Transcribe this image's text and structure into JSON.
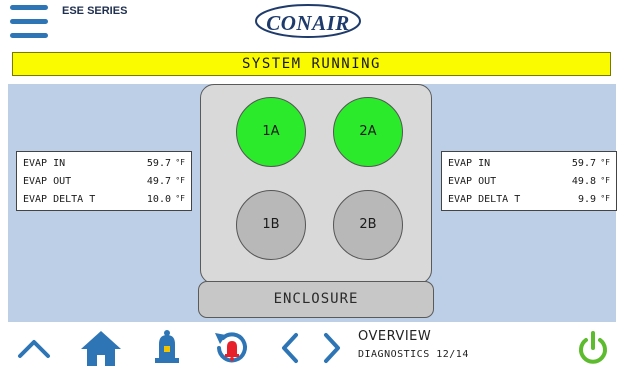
{
  "header": {
    "series": "ESE SERIES",
    "logo_text": "CONAIR"
  },
  "status": {
    "text": "SYSTEM RUNNING",
    "color": "#fbfb00"
  },
  "evap_left": {
    "rows": [
      {
        "label": "EVAP IN",
        "value": "59.7",
        "unit": "°F"
      },
      {
        "label": "EVAP OUT",
        "value": "49.7",
        "unit": "°F"
      },
      {
        "label": "EVAP DELTA T",
        "value": "10.0",
        "unit": "°F"
      }
    ]
  },
  "evap_right": {
    "rows": [
      {
        "label": "EVAP IN",
        "value": "59.7",
        "unit": "°F"
      },
      {
        "label": "EVAP OUT",
        "value": "49.8",
        "unit": "°F"
      },
      {
        "label": "EVAP DELTA T",
        "value": "9.9",
        "unit": "°F"
      }
    ]
  },
  "circuits": [
    {
      "label": "1A",
      "state": "running",
      "color": "#2bea2b"
    },
    {
      "label": "2A",
      "state": "running",
      "color": "#2bea2b"
    },
    {
      "label": "1B",
      "state": "off",
      "color": "#b8b8b8"
    },
    {
      "label": "2B",
      "state": "off",
      "color": "#b8b8b8"
    }
  ],
  "enclosure": {
    "label": "ENCLOSURE"
  },
  "nav": {
    "title": "OVERVIEW",
    "subtitle": "DIAGNOSTICS 12/14",
    "icons": [
      "chevron-up-icon",
      "home-icon",
      "bell-icon",
      "alarm-history-icon",
      "chevron-left-icon",
      "chevron-right-icon",
      "power-icon"
    ]
  },
  "colors": {
    "accent_blue": "#2e75b6",
    "background": "#bccfe6",
    "alarm_red": "#e8202a",
    "power_green": "#5dbb2e"
  }
}
